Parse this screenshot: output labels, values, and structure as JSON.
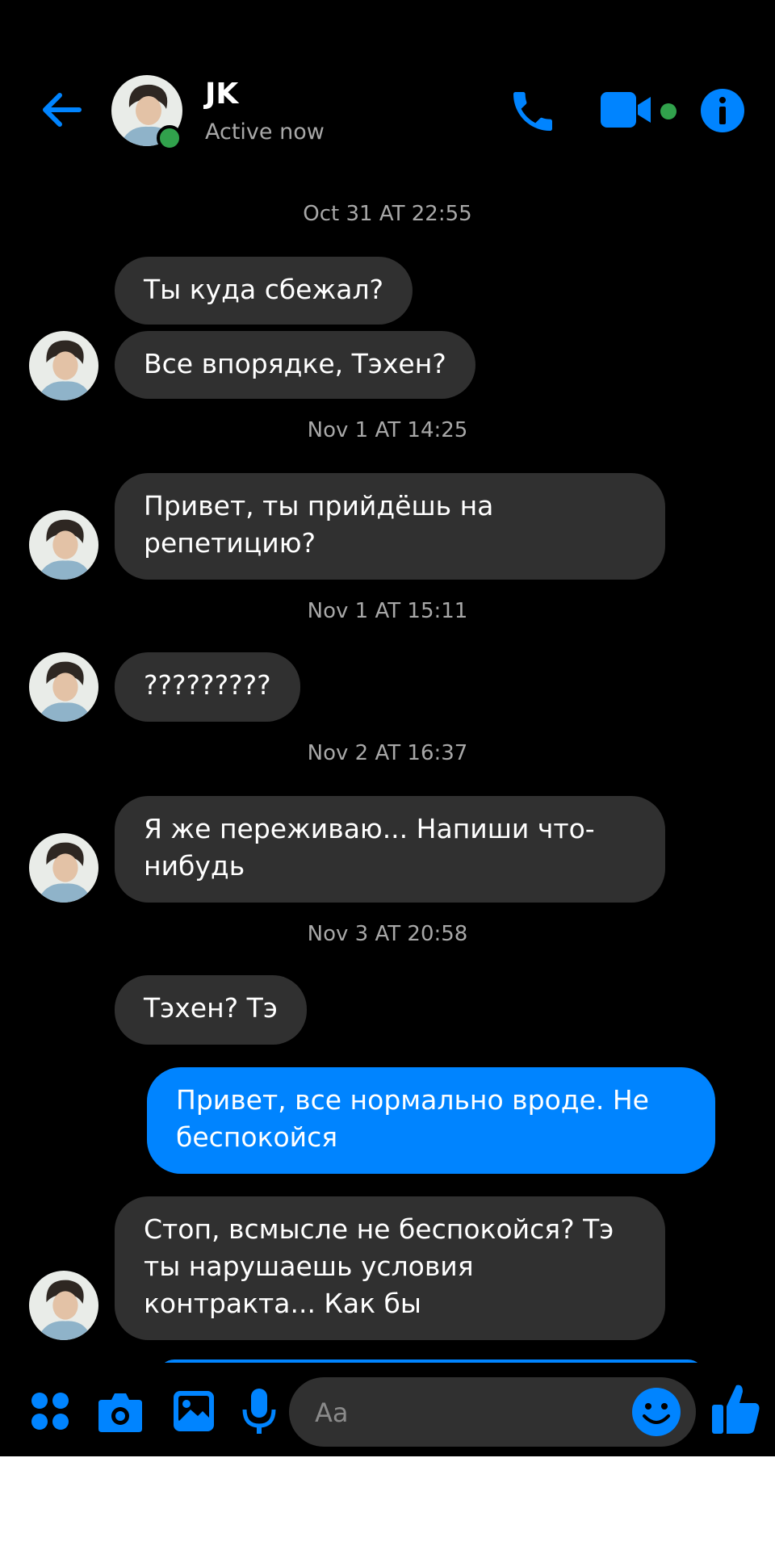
{
  "header": {
    "contact_name": "JK",
    "status": "Active now",
    "icons": [
      "back-arrow-icon",
      "phone-icon",
      "video-camera-icon",
      "info-icon"
    ]
  },
  "messages": [
    {
      "type": "timestamp",
      "text": "Oct 31 AT 22:55"
    },
    {
      "type": "incoming",
      "text": "Ты куда сбежал?"
    },
    {
      "type": "incoming",
      "text": "Все впорядке, Тэхен?"
    },
    {
      "type": "timestamp",
      "text": "Nov 1 AT 14:25"
    },
    {
      "type": "incoming",
      "text": "Привет, ты прийдёшь на репетицию?"
    },
    {
      "type": "timestamp",
      "text": "Nov 1 AT 15:11"
    },
    {
      "type": "incoming",
      "text": "?????????"
    },
    {
      "type": "timestamp",
      "text": "Nov 2 AT 16:37"
    },
    {
      "type": "incoming",
      "text": "Я же переживаю... Напиши что-нибудь"
    },
    {
      "type": "timestamp",
      "text": "Nov 3 AT 20:58"
    },
    {
      "type": "incoming",
      "text": "Тэхен? Тэ"
    },
    {
      "type": "outgoing",
      "text": "Привет, все нормально вроде. Не беспокойся"
    },
    {
      "type": "incoming",
      "text": "Стоп, всмысле не беспокойся? Тэ ты нарушаешь условия контракта... Как бы"
    }
  ],
  "composer": {
    "placeholder": "Aa",
    "icons": [
      "apps-icon",
      "camera-icon",
      "gallery-icon",
      "microphone-icon",
      "emoji-icon",
      "thumbs-up-icon"
    ]
  },
  "colors": {
    "background": "#000000",
    "accent": "#0084ff",
    "incoming_bubble": "#303030",
    "outgoing_bubble": "#0084ff",
    "online": "#31a24c",
    "timestamp": "#a8a8a8"
  }
}
